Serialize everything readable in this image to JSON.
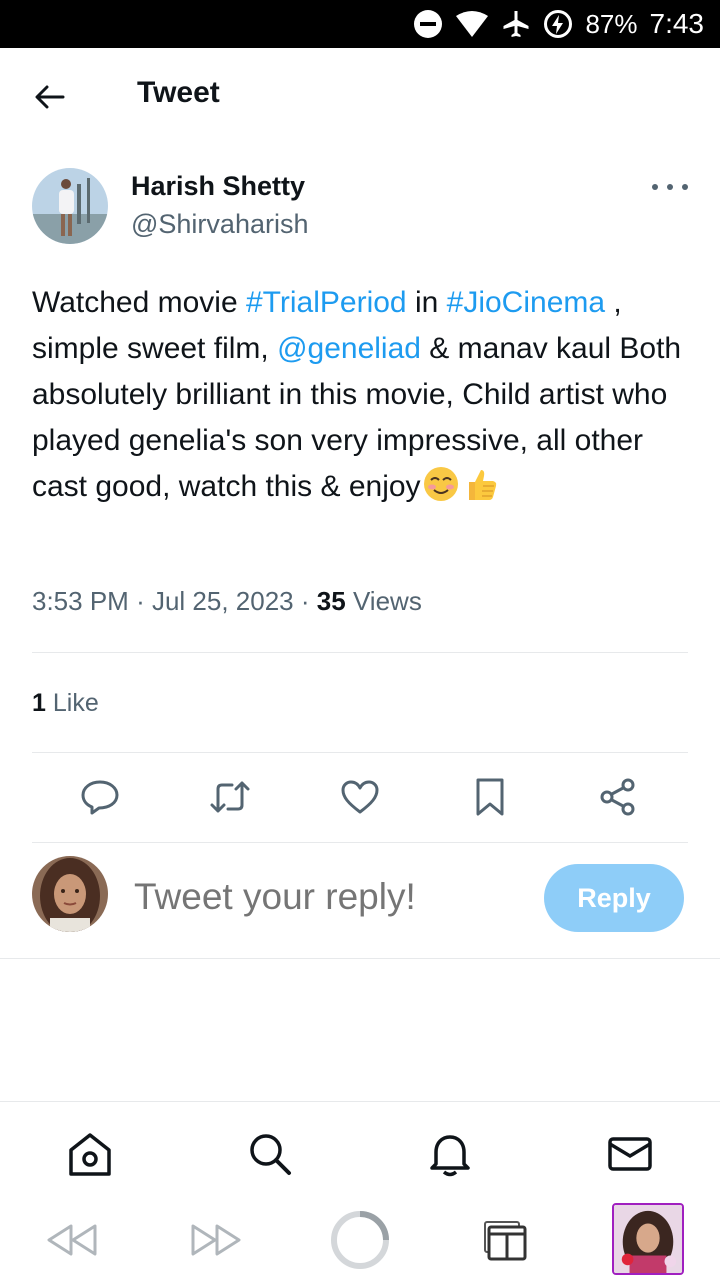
{
  "status_bar": {
    "battery": "87%",
    "time": "7:43",
    "icons": [
      "do-not-disturb-icon",
      "wifi-icon",
      "airplane-icon",
      "battery-charging-icon"
    ]
  },
  "header": {
    "title": "Tweet",
    "back_icon": "arrow-left-icon"
  },
  "tweet": {
    "author_name": "Harish Shetty",
    "author_handle": "@Shirvaharish",
    "text_segments": {
      "s1": "Watched movie ",
      "hashtag1": "#TrialPeriod",
      "s2": " in ",
      "hashtag2": "#JioCinema",
      "s3": " , simple sweet film, ",
      "mention": "@geneliad",
      "s4": " & manav kaul Both absolutely brilliant in this movie, Child artist who played genelia's son very impressive, all other cast good, watch this & enjoy"
    },
    "emojis": [
      "smiling-face-icon",
      "thumbs-up-icon"
    ],
    "time": "3:53 PM",
    "sep": "·",
    "date": "Jul 25, 2023",
    "views_count": "35",
    "views_label": "Views",
    "likes_count": "1",
    "likes_label": "Like"
  },
  "actions": [
    "reply-icon",
    "retweet-icon",
    "like-icon",
    "bookmark-icon",
    "share-icon"
  ],
  "reply": {
    "placeholder": "Tweet your reply!",
    "button_label": "Reply"
  },
  "bottom_nav": [
    "home-icon",
    "search-icon",
    "notifications-icon",
    "messages-icon"
  ],
  "browser_bar": [
    "back-icon",
    "forward-icon",
    "loading-icon",
    "tabs-icon",
    "profile-thumbnail"
  ],
  "colors": {
    "link": "#1d9bf0",
    "reply_button": "#8ecdf8",
    "secondary_text": "#536471"
  }
}
